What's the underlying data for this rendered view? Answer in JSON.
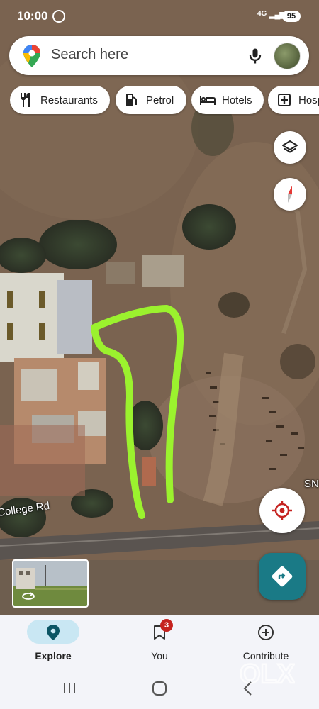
{
  "status_bar": {
    "time": "10:00",
    "network": "4G",
    "signal": "▂▄▆",
    "battery": "95"
  },
  "search": {
    "placeholder": "Search here"
  },
  "chips": [
    {
      "label": "Restaurants",
      "icon": "fork-knife-icon"
    },
    {
      "label": "Petrol",
      "icon": "fuel-pump-icon"
    },
    {
      "label": "Hotels",
      "icon": "bed-icon"
    },
    {
      "label": "Hosp",
      "icon": "hospital-icon"
    }
  ],
  "map": {
    "road_label": "College Rd",
    "edge_label": "SN",
    "annotation_color": "#9bf22e"
  },
  "bottom_nav": {
    "explore": "Explore",
    "you": "You",
    "you_badge": "3",
    "contribute": "Contribute"
  },
  "watermark": "OLX",
  "colors": {
    "accent": "#1a7a86",
    "explore_pill": "#c9e7f3",
    "badge": "#c5221f",
    "recenter": "#c5221f"
  }
}
